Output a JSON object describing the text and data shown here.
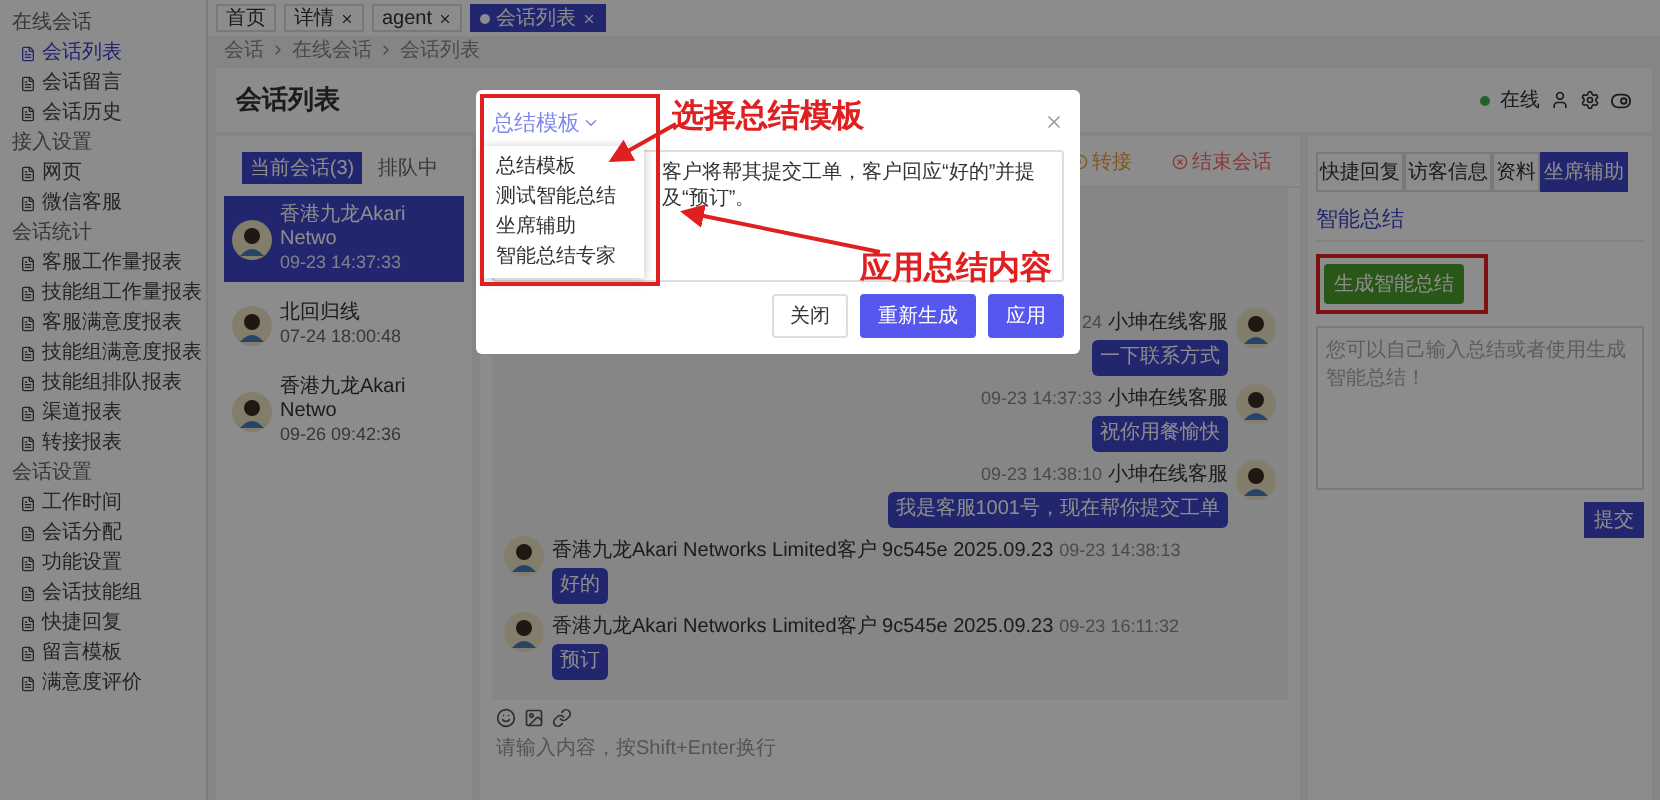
{
  "sidebar": {
    "groups": [
      {
        "title": "在线会话",
        "items": [
          {
            "label": "会话列表",
            "selected": true
          },
          {
            "label": "会话留言",
            "selected": false
          },
          {
            "label": "会话历史",
            "selected": false
          }
        ]
      },
      {
        "title": "接入设置",
        "items": [
          {
            "label": "网页",
            "selected": false
          },
          {
            "label": "微信客服",
            "selected": false
          }
        ]
      },
      {
        "title": "会话统计",
        "items": [
          {
            "label": "客服工作量报表",
            "selected": false
          },
          {
            "label": "技能组工作量报表",
            "selected": false
          },
          {
            "label": "客服满意度报表",
            "selected": false
          },
          {
            "label": "技能组满意度报表",
            "selected": false
          },
          {
            "label": "技能组排队报表",
            "selected": false
          },
          {
            "label": "渠道报表",
            "selected": false
          },
          {
            "label": "转接报表",
            "selected": false
          }
        ]
      },
      {
        "title": "会话设置",
        "items": [
          {
            "label": "工作时间",
            "selected": false
          },
          {
            "label": "会话分配",
            "selected": false
          },
          {
            "label": "功能设置",
            "selected": false
          },
          {
            "label": "会话技能组",
            "selected": false
          },
          {
            "label": "快捷回复",
            "selected": false
          },
          {
            "label": "留言模板",
            "selected": false
          },
          {
            "label": "满意度评价",
            "selected": false
          }
        ]
      }
    ]
  },
  "top_tabs": [
    {
      "label": "首页",
      "closable": false,
      "selected": false
    },
    {
      "label": "详情",
      "closable": true,
      "selected": false
    },
    {
      "label": "agent",
      "closable": true,
      "selected": false
    },
    {
      "label": "会话列表",
      "closable": true,
      "selected": true
    }
  ],
  "breadcrumb": [
    "会话",
    "在线会话",
    "会话列表"
  ],
  "page_title": "会话列表",
  "status": {
    "label": "在线",
    "online": true
  },
  "session_tabs": [
    {
      "label": "当前会话(3)",
      "selected": true
    },
    {
      "label": "排队中",
      "selected": false
    }
  ],
  "sessions": [
    {
      "name": "香港九龙Akari Netwo",
      "time": "09-23 14:37:33",
      "selected": true
    },
    {
      "name": "北回归线",
      "time": "07-24 18:00:48",
      "selected": false
    },
    {
      "name": "香港九龙Akari Netwo",
      "time": "09-26 09:42:36",
      "selected": false
    }
  ],
  "chat_actions": [
    {
      "label": "转接",
      "kind": "warning"
    },
    {
      "label": "结束会话",
      "kind": "danger"
    }
  ],
  "messages": [
    {
      "kind": "agent",
      "time": "24",
      "sender": "小坤在线客服",
      "text": "一下联系方式"
    },
    {
      "kind": "agent",
      "time": "09-23 14:37:33",
      "sender": "小坤在线客服",
      "text": "祝你用餐愉快"
    },
    {
      "kind": "agent",
      "time": "09-23 14:38:10",
      "sender": "小坤在线客服",
      "text": "我是客服1001号，现在帮你提交工单"
    },
    {
      "kind": "customer",
      "sender": "香港九龙Akari Networks Limited客户 9c545e 2025.09.23",
      "time": "09-23 14:38:13",
      "text": "好的"
    },
    {
      "kind": "customer",
      "sender": "香港九龙Akari Networks Limited客户 9c545e 2025.09.23",
      "time": "09-23 16:11:32",
      "text": "预订"
    }
  ],
  "input": {
    "placeholder": "请输入内容，按Shift+Enter换行"
  },
  "right_tabs": [
    {
      "label": "快捷回复",
      "selected": false
    },
    {
      "label": "访客信息",
      "selected": false
    },
    {
      "label": "资料",
      "selected": false
    },
    {
      "label": "坐席辅助",
      "selected": true
    }
  ],
  "summary_panel": {
    "title": "智能总结",
    "generate_button": "生成智能总结",
    "placeholder": "您可以自己输入总结或者使用生成智能总结！",
    "submit_button": "提交"
  },
  "modal": {
    "template_select": {
      "value": "总结模板",
      "expanded": true,
      "options": [
        "总结模板",
        "测试智能总结",
        "坐席辅助",
        "智能总结专家"
      ]
    },
    "content": "客户将帮其提交工单，客户回应“好的”并提及“预订”。",
    "buttons": [
      {
        "label": "关闭",
        "kind": "default"
      },
      {
        "label": "重新生成",
        "kind": "primary"
      },
      {
        "label": "应用",
        "kind": "primary"
      }
    ]
  },
  "annotations": [
    {
      "text": "选择总结模板"
    },
    {
      "text": "应用总结内容"
    }
  ]
}
